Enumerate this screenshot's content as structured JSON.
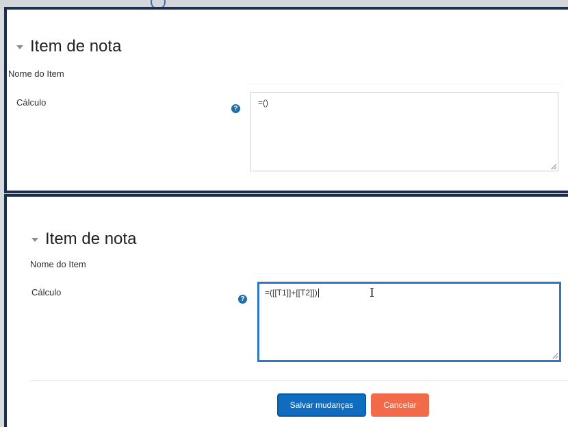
{
  "section1": {
    "title": "Item de nota",
    "name_label": "Nome do Item",
    "calc_label": "Cálculo",
    "help": "?",
    "calc_value": "=()"
  },
  "section2": {
    "title": "Item de nota",
    "name_label": "Nome do Item",
    "calc_label": "Cálculo",
    "help": "?",
    "calc_value": "=([[T1]]+[[T2]])"
  },
  "actions": {
    "save_label": "Salvar mudanças",
    "cancel_label": "Cancelar"
  },
  "colors": {
    "frame": "#1c2f4d",
    "primary": "#0f6cbf",
    "danger": "#f16a4a",
    "focus": "#2e76c8"
  }
}
